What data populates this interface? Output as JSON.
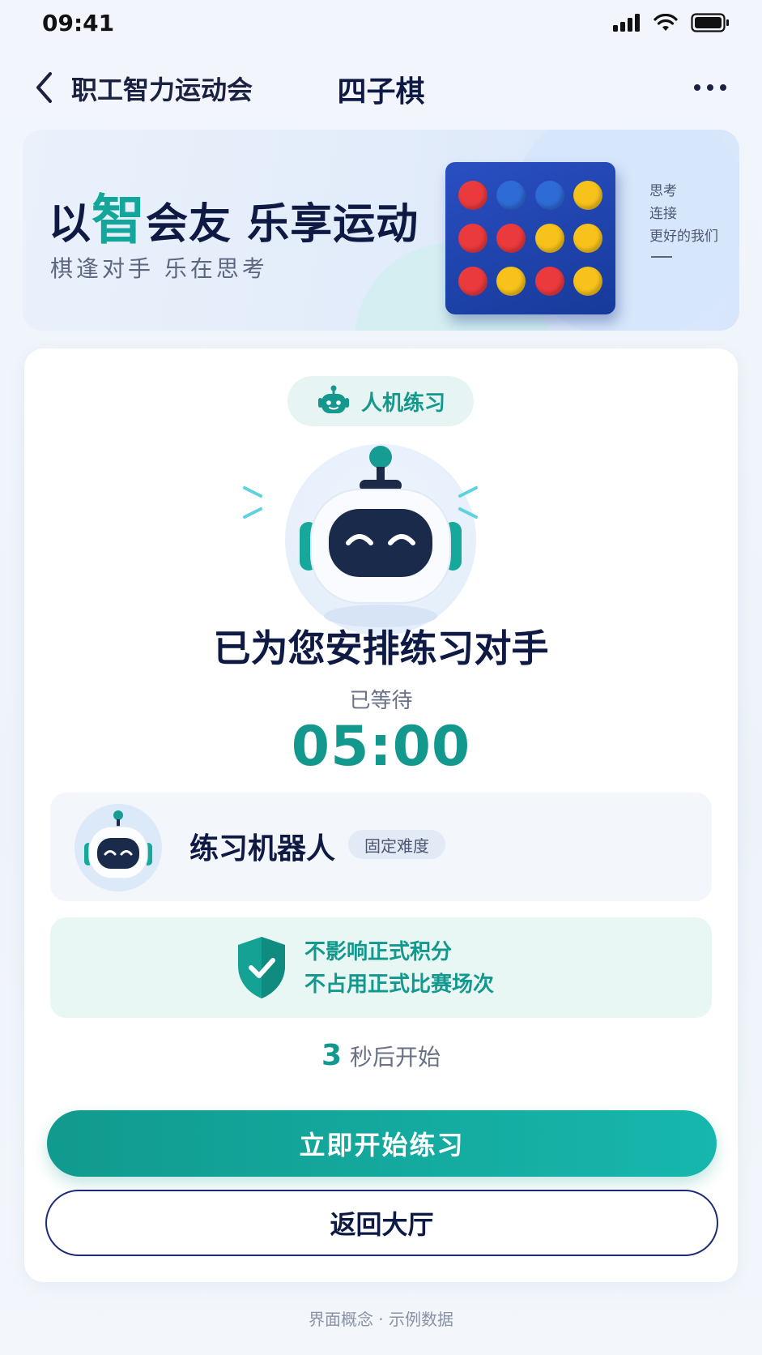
{
  "status_bar": {
    "time": "09:41"
  },
  "nav": {
    "back_label": "职工智力运动会",
    "title": "四子棋"
  },
  "banner": {
    "title_pre": "以",
    "title_accent": "智",
    "title_post": "会友  乐享运动",
    "subtitle": "棋逢对手  乐在思考",
    "side_lines": [
      "思考",
      "连接",
      "更好的我们"
    ],
    "board_discs": [
      "red",
      "blue",
      "blue",
      "yellow",
      "red",
      "red",
      "yellow",
      "yellow",
      "red",
      "yellow",
      "red",
      "yellow"
    ]
  },
  "mode_chip": {
    "label": "人机练习",
    "icon": "robot-icon"
  },
  "match": {
    "title": "已为您安排练习对手",
    "waiting_label": "已等待",
    "timer": "05:00"
  },
  "opponent": {
    "name": "练习机器人",
    "badge": "固定难度"
  },
  "notice": {
    "line1": "不影响正式积分",
    "line2": "不占用正式比赛场次",
    "icon": "shield-check-icon"
  },
  "countdown": {
    "number": "3",
    "text": "秒后开始"
  },
  "buttons": {
    "start": "立即开始练习",
    "back_hall": "返回大厅"
  },
  "footer": {
    "note": "界面概念 · 示例数据"
  },
  "colors": {
    "accent": "#13988d",
    "navy": "#0f1a44",
    "red": "#ea3a3e",
    "blue": "#2f6bd6",
    "yellow": "#f7c21b"
  }
}
